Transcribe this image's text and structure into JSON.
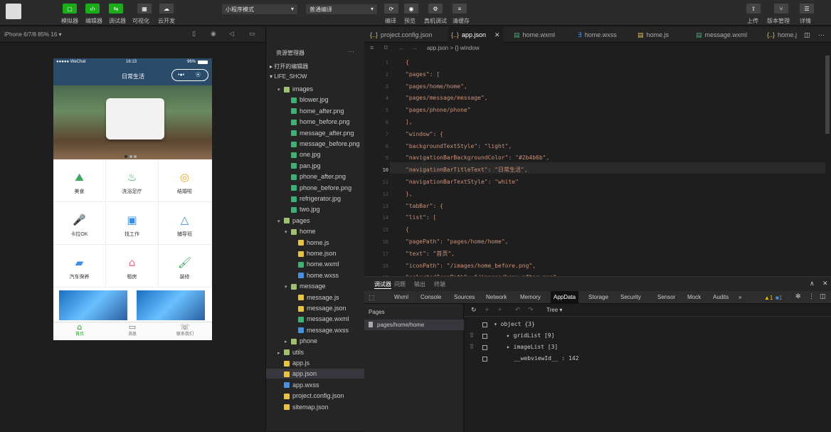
{
  "toolbar": {
    "left_buttons": [
      "模拟器",
      "编辑器",
      "调试器",
      "可视化",
      "云开发"
    ],
    "mode_select": "小程序模式",
    "compile_select": "普通编译",
    "center_labels": [
      "编译",
      "预览",
      "真机调试",
      "清缓存"
    ],
    "right_labels": [
      "上传",
      "版本管理",
      "详情"
    ]
  },
  "device": {
    "label": "iPhone 6/7/8 85% 16 ▾"
  },
  "phone": {
    "status_left": "●●●●● WeChat",
    "status_time": "16:13",
    "status_battery": "96%",
    "nav_title": "日常生活",
    "grid": [
      {
        "label": "美食",
        "icon": "food-icon"
      },
      {
        "label": "洗浴足疗",
        "icon": "bath-icon"
      },
      {
        "label": "结婚啦",
        "icon": "ring-icon"
      },
      {
        "label": "卡拉OK",
        "icon": "mic-icon"
      },
      {
        "label": "找工作",
        "icon": "briefcase-icon"
      },
      {
        "label": "辅导班",
        "icon": "graduation-icon"
      },
      {
        "label": "汽车保养",
        "icon": "car-icon"
      },
      {
        "label": "租房",
        "icon": "house-icon"
      },
      {
        "label": "装修",
        "icon": "paint-roller-icon"
      }
    ],
    "tabbar": [
      {
        "label": "首页",
        "icon": "home-icon"
      },
      {
        "label": "消息",
        "icon": "message-icon"
      },
      {
        "label": "联系我们",
        "icon": "phone-icon"
      }
    ]
  },
  "explorer": {
    "title": "资源管理器",
    "open_editors": "打开的编辑器",
    "project": "LIFE_SHOW",
    "tree": [
      {
        "label": "images",
        "depth": 1,
        "type": "folder-open"
      },
      {
        "label": "blower.jpg",
        "depth": 2,
        "type": "image"
      },
      {
        "label": "home_after.png",
        "depth": 2,
        "type": "image"
      },
      {
        "label": "home_before.png",
        "depth": 2,
        "type": "image"
      },
      {
        "label": "message_after.png",
        "depth": 2,
        "type": "image"
      },
      {
        "label": "message_before.png",
        "depth": 2,
        "type": "image"
      },
      {
        "label": "one.jpg",
        "depth": 2,
        "type": "image"
      },
      {
        "label": "pan.jpg",
        "depth": 2,
        "type": "image"
      },
      {
        "label": "phone_after.png",
        "depth": 2,
        "type": "image"
      },
      {
        "label": "phone_before.png",
        "depth": 2,
        "type": "image"
      },
      {
        "label": "refrigerator.jpg",
        "depth": 2,
        "type": "image"
      },
      {
        "label": "two.jpg",
        "depth": 2,
        "type": "image"
      },
      {
        "label": "pages",
        "depth": 1,
        "type": "folder-open"
      },
      {
        "label": "home",
        "depth": 2,
        "type": "folder-open"
      },
      {
        "label": "home.js",
        "depth": 3,
        "type": "js"
      },
      {
        "label": "home.json",
        "depth": 3,
        "type": "json"
      },
      {
        "label": "home.wxml",
        "depth": 3,
        "type": "wxml"
      },
      {
        "label": "home.wxss",
        "depth": 3,
        "type": "wxss"
      },
      {
        "label": "message",
        "depth": 2,
        "type": "folder-open"
      },
      {
        "label": "message.js",
        "depth": 3,
        "type": "js"
      },
      {
        "label": "message.json",
        "depth": 3,
        "type": "json"
      },
      {
        "label": "message.wxml",
        "depth": 3,
        "type": "wxml"
      },
      {
        "label": "message.wxss",
        "depth": 3,
        "type": "wxss"
      },
      {
        "label": "phone",
        "depth": 2,
        "type": "folder"
      },
      {
        "label": "utils",
        "depth": 1,
        "type": "folder"
      },
      {
        "label": "app.js",
        "depth": 1,
        "type": "js"
      },
      {
        "label": "app.json",
        "depth": 1,
        "type": "json"
      },
      {
        "label": "app.wxss",
        "depth": 1,
        "type": "wxss"
      },
      {
        "label": "project.config.json",
        "depth": 1,
        "type": "json"
      },
      {
        "label": "sitemap.json",
        "depth": 1,
        "type": "json"
      }
    ]
  },
  "editor": {
    "tabs": [
      {
        "label": "project.config.json",
        "icon": "json-icon"
      },
      {
        "label": "app.json",
        "icon": "json-icon"
      },
      {
        "label": "home.wxml",
        "icon": "wxml-icon"
      },
      {
        "label": "home.wxss",
        "icon": "wxss-icon"
      },
      {
        "label": "home.js",
        "icon": "js-icon"
      },
      {
        "label": "message.wxml",
        "icon": "wxml-icon"
      },
      {
        "label": "home.j",
        "icon": "json-icon"
      }
    ],
    "breadcrumb": "app.json > {} window",
    "lines": [
      {
        "n": "1",
        "t": "{"
      },
      {
        "n": "2",
        "t": "  \"pages\": ["
      },
      {
        "n": "3",
        "t": "    \"pages/home/home\","
      },
      {
        "n": "4",
        "t": "    \"pages/message/message\","
      },
      {
        "n": "5",
        "t": "    \"pages/phone/phone\""
      },
      {
        "n": "6",
        "t": "  ],"
      },
      {
        "n": "7",
        "t": "  \"window\": {"
      },
      {
        "n": "8",
        "t": "    \"backgroundTextStyle\": \"light\","
      },
      {
        "n": "9",
        "t": "    \"navigationBarBackgroundColor\": \"#2b4b6b\","
      },
      {
        "n": "10",
        "t": "    \"navigationBarTitleText\": \"日常生活\","
      },
      {
        "n": "11",
        "t": "    \"navigationBarTextStyle\": \"white\""
      },
      {
        "n": "12",
        "t": "  },"
      },
      {
        "n": "13",
        "t": "  \"tabBar\": {"
      },
      {
        "n": "14",
        "t": "    \"list\": ["
      },
      {
        "n": "15",
        "t": "      {"
      },
      {
        "n": "16",
        "t": "        \"pagePath\": \"pages/home/home\","
      },
      {
        "n": "17",
        "t": "        \"text\": \"首页\","
      },
      {
        "n": "18",
        "t": "        \"iconPath\": \"/images/home_before.png\","
      },
      {
        "n": "19",
        "t": "        \"selectedIconPath\": \"/images/home_after.png\""
      }
    ]
  },
  "devtools": {
    "top_tabs": [
      "调试器",
      "问题",
      "输出",
      "终端"
    ],
    "tabs": [
      "Wxml",
      "Console",
      "Sources",
      "Network",
      "Memory",
      "AppData",
      "Storage",
      "Security",
      "Sensor",
      "Mock",
      "Audits",
      "»"
    ],
    "warnings": "▲1",
    "infos": "■1",
    "pages_title": "Pages",
    "page_item": "pages/home/home",
    "view_mode": "Tree ▾",
    "tree": [
      "▾ object {3}",
      "▸ gridList [9]",
      "▸ imageList [3]",
      "__webviewId__ : 142"
    ]
  },
  "colors": {
    "nav_bar": "#2b4b6b",
    "toolbar_green": "#1aad19"
  }
}
